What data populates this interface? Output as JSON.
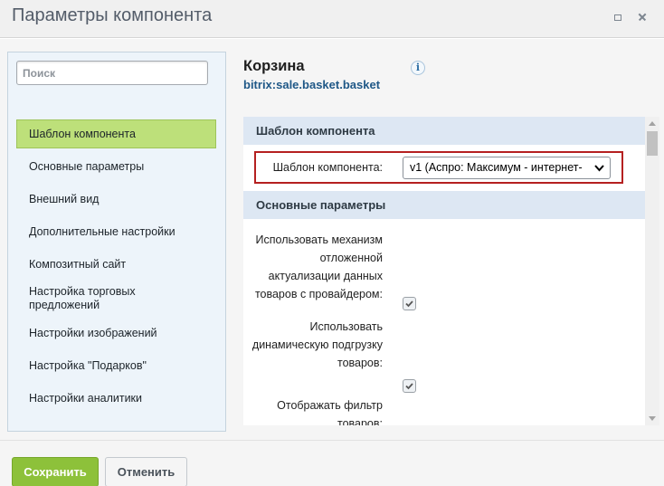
{
  "window": {
    "title": "Параметры компонента"
  },
  "sidebar": {
    "search_placeholder": "Поиск",
    "items": [
      {
        "label": "Шаблон компонента",
        "active": true
      },
      {
        "label": "Основные параметры"
      },
      {
        "label": "Внешний вид"
      },
      {
        "label": "Дополнительные настройки"
      },
      {
        "label": "Композитный сайт"
      },
      {
        "label": "Настройка торговых предложений"
      },
      {
        "label": "Настройки изображений"
      },
      {
        "label": "Настройка \"Подарков\""
      },
      {
        "label": "Настройки аналитики"
      }
    ]
  },
  "component": {
    "name": "Корзина",
    "id": "bitrix:sale.basket.basket"
  },
  "sections": {
    "template": {
      "title": "Шаблон компонента",
      "field_label": "Шаблон компонента:",
      "selected_value": "v1 (Аспро: Максимум - интернет-"
    },
    "main": {
      "title": "Основные параметры",
      "params": [
        {
          "label": "Использовать механизм отложенной актуализации данных товаров с провайдером:",
          "checked": true
        },
        {
          "label": "Использовать динамическую подгрузку товаров:",
          "checked": true
        },
        {
          "label": "Отображать фильтр товаров:",
          "checked": true
        }
      ]
    }
  },
  "footer": {
    "save_label": "Сохранить",
    "cancel_label": "Отменить"
  },
  "colors": {
    "active_item": "#bde07a",
    "save_button": "#8dc13a",
    "section_header": "#dde7f3",
    "highlight_border": "#b52020",
    "link_blue": "#1f5887"
  }
}
